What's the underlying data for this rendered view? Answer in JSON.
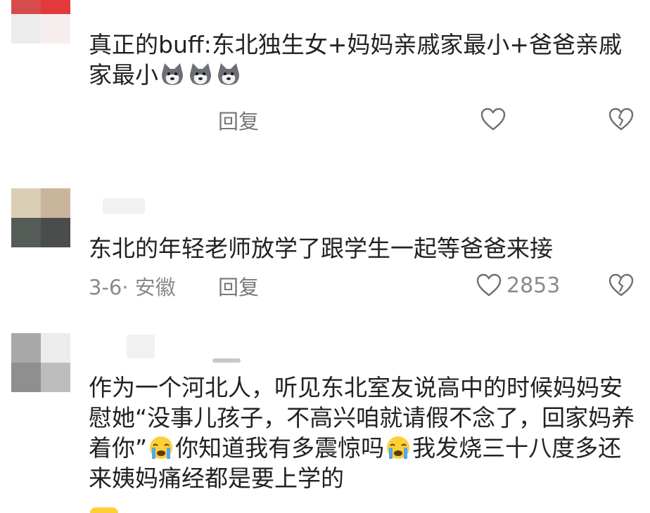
{
  "comments": [
    {
      "text_parts": [
        "真正的buff:东北独生女+妈妈亲戚家最小+爸爸亲戚家最小"
      ],
      "emoji": "husky-dog-emoji",
      "emoji_count": 3,
      "date": "",
      "reply_label": "回复",
      "likes": "",
      "avatar_colors": [
        "#d64c4c",
        "#e23a3a",
        "#ececec",
        "#f6eded"
      ]
    },
    {
      "text": "东北的年轻老师放学了跟学生一起等爸爸来接",
      "date": "3-6· 安徽",
      "reply_label": "回复",
      "likes": "2853",
      "avatar_colors": [
        "#d9cdb3",
        "#c9b49c",
        "#555b56",
        "#4a4d4b"
      ]
    },
    {
      "text_line1": "作为一个河北人，听见东北室友说高中的时候妈妈安慰她“没事儿孩子，不高兴咱就请假不念了，回家妈养着你”",
      "text_line2": "你知道我有多震惊吗",
      "text_line3": "我发烧三十八度多还来姨妈痛经都是要上学的",
      "emoji": "crying-face-emoji",
      "avatar_colors": [
        "#a9a9a9",
        "#ececec",
        "#8f8f8f",
        "#bdbdbd"
      ]
    }
  ],
  "colors": {
    "text": "#222222",
    "meta": "#8a8a8a",
    "icon": "#6f6f6f"
  }
}
